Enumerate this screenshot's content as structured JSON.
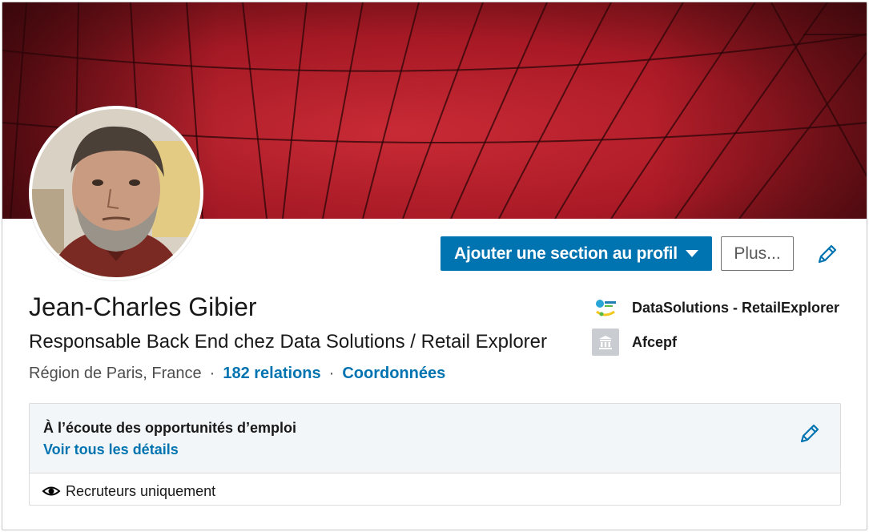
{
  "profile": {
    "name": "Jean-Charles Gibier",
    "headline": "Responsable Back End chez Data Solutions / Retail Explorer",
    "location": "Région de Paris, France",
    "separator": "·",
    "connections": "182 relations",
    "contact_info": "Coordonnées"
  },
  "actions": {
    "add_section_label": "Ajouter une section au profil",
    "more_label": "Plus..."
  },
  "organizations": [
    {
      "label": "DataSolutions - RetailExplorer",
      "logo": "datasolutions-logo"
    },
    {
      "label": "Afcepf",
      "logo": "school-icon"
    }
  ],
  "opportunities": {
    "title": "À l’écoute des opportunités d’emploi",
    "details_link": "Voir tous les détails",
    "visibility": "Recruteurs uniquement"
  },
  "colors": {
    "accent": "#0073b1",
    "banner": "#c0222e",
    "panel": "#f3f6f8"
  }
}
